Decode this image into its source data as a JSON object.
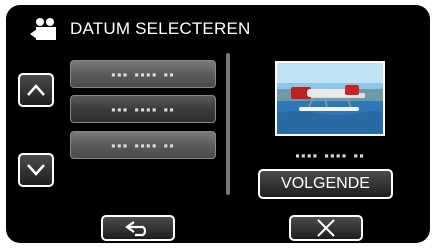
{
  "header": {
    "title": "DATUM SELECTEREN",
    "icon": "video-camera-icon"
  },
  "dates": {
    "items": [
      {
        "label": "▪▪▪ ▪▪▪▪ ▪▪"
      },
      {
        "label": "▪▪▪ ▪▪▪▪ ▪▪"
      },
      {
        "label": "▪▪▪ ▪▪▪▪ ▪▪"
      }
    ]
  },
  "preview": {
    "date_label": "▪▪▪▪ ▪▪▪▪ ▪▪"
  },
  "buttons": {
    "next_label": "VOLGENDE"
  },
  "nav": {
    "up_icon": "chevron-up-icon",
    "down_icon": "chevron-down-icon",
    "back_icon": "back-arrow-icon",
    "close_icon": "close-icon"
  }
}
